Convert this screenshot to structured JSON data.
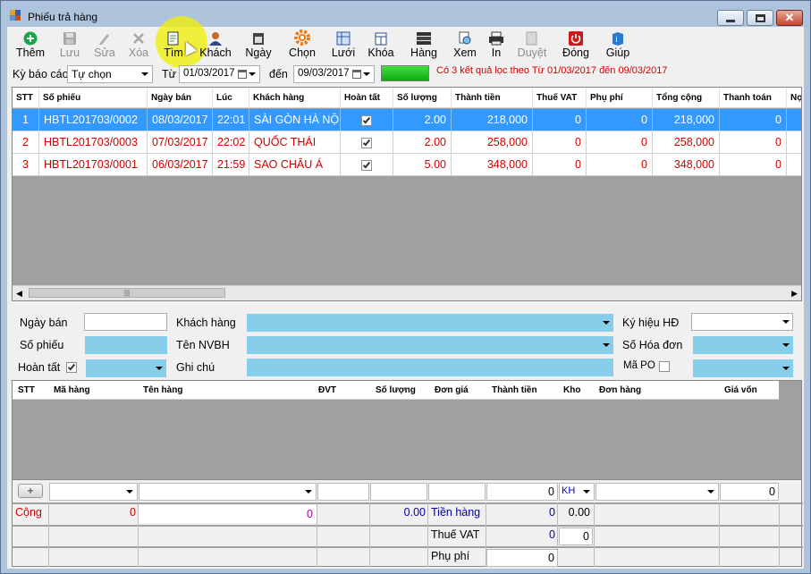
{
  "window": {
    "title": "Phiếu trả hàng"
  },
  "toolbar": [
    {
      "name": "add",
      "label": "Thêm",
      "icon": "plus-circle-icon",
      "disabled": false
    },
    {
      "name": "save",
      "label": "Lưu",
      "icon": "floppy-disk-icon",
      "disabled": true
    },
    {
      "name": "edit",
      "label": "Sửa",
      "icon": "pencil-icon",
      "disabled": true
    },
    {
      "name": "delete",
      "label": "Xóa",
      "icon": "x-icon",
      "disabled": true
    },
    {
      "name": "find",
      "label": "Tìm",
      "icon": "find-document-icon",
      "disabled": false
    },
    {
      "name": "customer",
      "label": "Khách",
      "icon": "customer-icon",
      "disabled": false
    },
    {
      "name": "date",
      "label": "Ngày",
      "icon": "calendar-icon",
      "disabled": false
    },
    {
      "name": "choose",
      "label": "Chọn",
      "icon": "gear-icon",
      "disabled": false
    },
    {
      "name": "grid",
      "label": "Lưới",
      "icon": "grid-layout-icon",
      "disabled": false
    },
    {
      "name": "lock",
      "label": "Khóa",
      "icon": "lock-column-icon",
      "disabled": false
    },
    {
      "name": "goods",
      "label": "Hàng",
      "icon": "goods-stack-icon",
      "disabled": false
    },
    {
      "name": "view",
      "label": "Xem",
      "icon": "preview-icon",
      "disabled": false
    },
    {
      "name": "print",
      "label": "In",
      "icon": "printer-icon",
      "disabled": false
    },
    {
      "name": "approve",
      "label": "Duyệt",
      "icon": "approve-document-icon",
      "disabled": true
    },
    {
      "name": "close",
      "label": "Đóng",
      "icon": "power-icon",
      "disabled": false
    },
    {
      "name": "help",
      "label": "Giúp",
      "icon": "help-book-icon",
      "disabled": false
    }
  ],
  "filter": {
    "period_label": "Kỳ báo cáo",
    "period_value": "Tự chọn",
    "from_label": "Từ",
    "from_date": "01/03/2017",
    "to_label": "đến",
    "to_date": "09/03/2017",
    "result_text": "Có 3 kết quả lọc theo Từ 01/03/2017 đến 09/03/2017"
  },
  "grid": {
    "columns": [
      "STT",
      "Số phiếu",
      "Ngày bán",
      "Lúc",
      "Khách hàng",
      "Hoàn tất",
      "Số lượng",
      "Thành tiền",
      "Thuế VAT",
      "Phụ phí",
      "Tổng cộng",
      "Thanh toán",
      "Nợ"
    ],
    "rows": [
      {
        "stt": "1",
        "so_phieu": "HBTL201703/0002",
        "ngay_ban": "08/03/2017",
        "luc": "22:01",
        "khach_hang": "SÀI GÒN HÀ NỘI",
        "hoan_tat": true,
        "so_luong": "2.00",
        "thanh_tien": "218,000",
        "thue_vat": "0",
        "phu_phi": "0",
        "tong_cong": "218,000",
        "thanh_toan": "0",
        "selected": true
      },
      {
        "stt": "2",
        "so_phieu": "HBTL201703/0003",
        "ngay_ban": "07/03/2017",
        "luc": "22:02",
        "khach_hang": "QUỐC THÁI",
        "hoan_tat": true,
        "so_luong": "2.00",
        "thanh_tien": "258,000",
        "thue_vat": "0",
        "phu_phi": "0",
        "tong_cong": "258,000",
        "thanh_toan": "0",
        "selected": false
      },
      {
        "stt": "3",
        "so_phieu": "HBTL201703/0001",
        "ngay_ban": "06/03/2017",
        "luc": "21:59",
        "khach_hang": "SAO CHÂU Á",
        "hoan_tat": true,
        "so_luong": "5.00",
        "thanh_tien": "348,000",
        "thue_vat": "0",
        "phu_phi": "0",
        "tong_cong": "348,000",
        "thanh_toan": "0",
        "selected": false
      }
    ]
  },
  "form": {
    "ngay_ban": "Ngày bán",
    "so_phieu": "Số phiếu",
    "hoan_tat": "Hoàn tất",
    "khach_hang": "Khách hàng",
    "ten_nvbh": "Tên NVBH",
    "ghi_chu": "Ghi chú",
    "ky_hieu_hd": "Ký hiệu HĐ",
    "so_hoa_don": "Số Hóa đơn",
    "ma_po": "Mã PO"
  },
  "detail": {
    "columns": [
      "STT",
      "Mã hàng",
      "Tên hàng",
      "ĐVT",
      "Số lượng",
      "Đơn giá",
      "Thành tiền",
      "Kho",
      "Đơn hàng",
      "Giá vốn"
    ]
  },
  "footer": {
    "entry_thanh_tien": "0",
    "entry_kho": "KH",
    "entry_gia_von": "0",
    "cong_label": "Cộng",
    "cong_ma_hang": "0",
    "cong_ten_hang": "0",
    "cong_so_luong": "0.00",
    "tien_hang_label": "Tiền hàng",
    "tien_hang": "0",
    "tien_hang_kho": "0.00",
    "thue_vat_label": "Thuế VAT",
    "thue_vat": "0",
    "thue_vat_kho": "0",
    "phu_phi_label": "Phụ phí",
    "phu_phi": "0"
  },
  "colors": {
    "accent_red": "#d00000",
    "selection": "#3399ff",
    "field_blue": "#87ceeb",
    "progress_green": "#22bb22"
  }
}
